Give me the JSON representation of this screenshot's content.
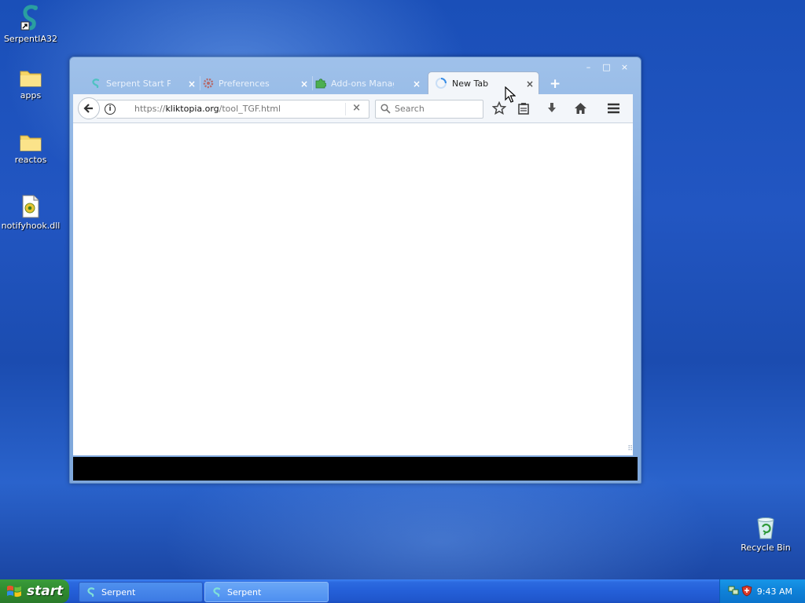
{
  "desktop": {
    "icons": [
      {
        "label": "SerpentIA32"
      },
      {
        "label": "apps"
      },
      {
        "label": "reactos"
      },
      {
        "label": "notifyhook.dll"
      },
      {
        "label": "Recycle Bin"
      }
    ]
  },
  "browser": {
    "tabs": [
      {
        "title": "Serpent Start Pa",
        "icon": "serpent-icon",
        "active": false
      },
      {
        "title": "Preferences",
        "icon": "gear-icon",
        "active": false
      },
      {
        "title": "Add-ons Manage",
        "icon": "puzzle-icon",
        "active": false
      },
      {
        "title": "New Tab",
        "icon": "loading-icon",
        "active": true
      }
    ],
    "close_glyph": "×",
    "new_tab_glyph": "+",
    "url": {
      "prefix": "https://",
      "domain": "kliktopia.org",
      "path": "/tool_TGF.html"
    },
    "search_placeholder": "Search",
    "window_controls": {
      "minimize": "–",
      "maximize": "□",
      "close": "×"
    }
  },
  "taskbar": {
    "start_label": "start",
    "tasks": [
      {
        "label": "Serpent",
        "active": false
      },
      {
        "label": "Serpent",
        "active": true
      }
    ],
    "clock": "9:43 AM"
  },
  "colors": {
    "desktop": "#1f52bd",
    "taskbar": "#245fd8",
    "start": "#2f8a2f",
    "tray": "#0f81d8"
  }
}
